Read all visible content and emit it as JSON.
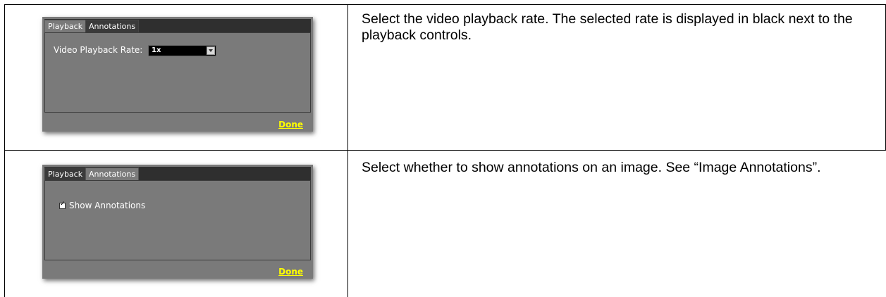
{
  "rows": [
    {
      "panel": {
        "tabs": [
          {
            "label": "Playback",
            "active": true
          },
          {
            "label": "Annotations",
            "active": false
          }
        ],
        "field_label": "Video Playback Rate:",
        "select_value": "1x",
        "done_label": "Done"
      },
      "description": "Select the video playback rate. The selected rate is displayed in black next to the playback controls."
    },
    {
      "panel": {
        "tabs": [
          {
            "label": "Playback",
            "active": false
          },
          {
            "label": "Annotations",
            "active": true
          }
        ],
        "checkbox_label": "Show Annotations",
        "checkbox_checked": true,
        "done_label": "Done"
      },
      "description": "Select whether to show annotations on an image. See “Image Annotations”."
    }
  ],
  "colors": {
    "panel_bg": "#7a7a7a",
    "tabstrip_bg": "#2f2f2f",
    "done_link": "#ffff00",
    "select_bg": "#000000"
  }
}
